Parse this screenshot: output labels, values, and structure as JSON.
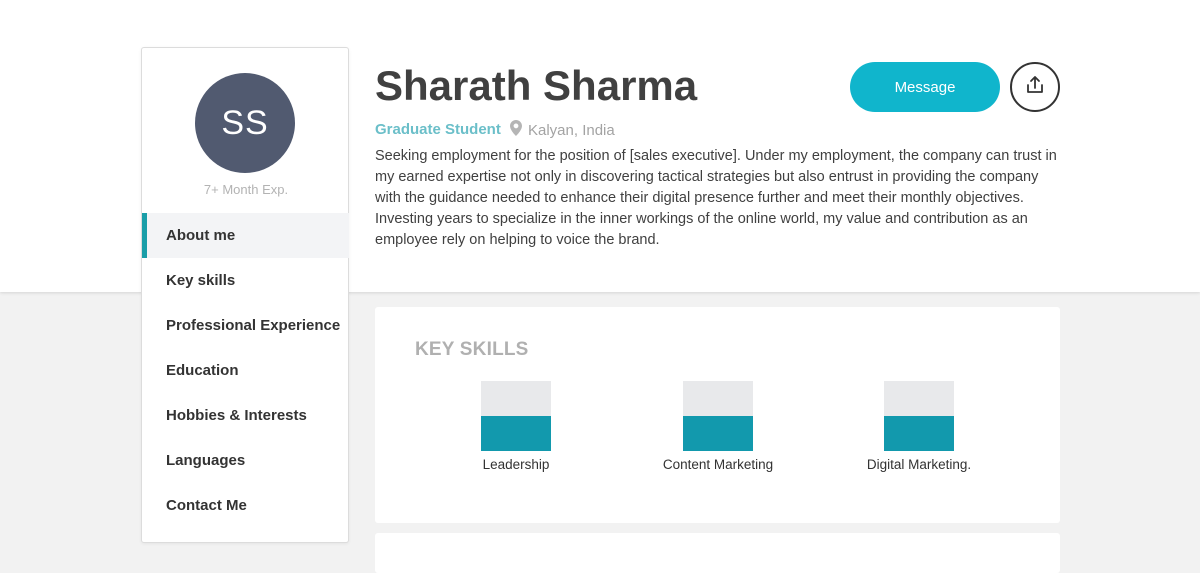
{
  "profile": {
    "initials": "SS",
    "experience": "7+ Month Exp.",
    "name": "Sharath Sharma",
    "role": "Graduate Student",
    "location": "Kalyan, India",
    "bio": "Seeking employment for the position of [sales executive]. Under my employment, the company can trust in my earned expertise not only in discovering tactical strategies but also entrust in providing the company with the guidance needed to enhance their digital presence further and meet their monthly objectives. Investing years to specialize in the inner workings of the online world, my value and contribution as an employee rely on helping to voice the brand."
  },
  "actions": {
    "message_label": "Message",
    "share_icon": "share-upload-icon"
  },
  "nav": {
    "items": [
      {
        "label": "About me",
        "active": true
      },
      {
        "label": "Key skills",
        "active": false
      },
      {
        "label": "Professional Experience",
        "active": false
      },
      {
        "label": "Education",
        "active": false
      },
      {
        "label": "Hobbies & Interests",
        "active": false
      },
      {
        "label": "Languages",
        "active": false
      },
      {
        "label": "Contact Me",
        "active": false
      }
    ]
  },
  "key_skills": {
    "title": "KEY SKILLS",
    "skills": [
      {
        "label": "Leadership",
        "level": 0.5
      },
      {
        "label": "Content Marketing",
        "level": 0.5
      },
      {
        "label": "Digital Marketing.",
        "level": 0.5
      }
    ]
  },
  "colors": {
    "accent": "#10b5cc",
    "nav_active_border": "#1a9ea8",
    "avatar_bg": "#515a70",
    "skill_fill": "#1299ad",
    "role_text": "#6bbfc9"
  }
}
